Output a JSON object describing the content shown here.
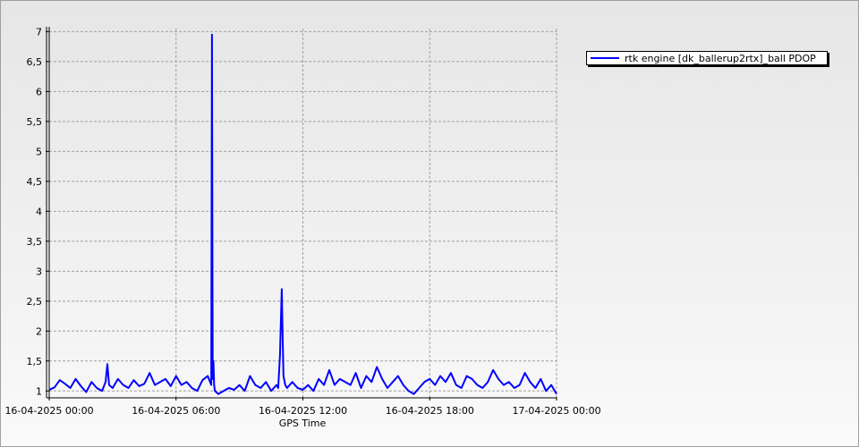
{
  "chart_data": {
    "type": "line",
    "title": "",
    "xlabel": "GPS Time",
    "ylabel": "",
    "x_tick_labels": [
      "16-04-2025 00:00",
      "16-04-2025 06:00",
      "16-04-2025 12:00",
      "16-04-2025 18:00",
      "17-04-2025 00:00"
    ],
    "xlim": [
      "16-04-2025 00:00",
      "17-04-2025 00:00"
    ],
    "y_tick_labels": [
      "1",
      "1,5",
      "2",
      "2,5",
      "3",
      "3,5",
      "4",
      "4,5",
      "5",
      "5,5",
      "6",
      "6,5",
      "7"
    ],
    "ylim": [
      0.9,
      7.05
    ],
    "grid": true,
    "legend_position": "top-right",
    "colors": {
      "series": "#0000ff"
    },
    "series": [
      {
        "name": "rtk engine [dk_ballerup2rtx]_ball PDOP",
        "x": [
          "16-04-2025 00:00",
          "16-04-2025 00:15",
          "16-04-2025 00:30",
          "16-04-2025 00:45",
          "16-04-2025 01:00",
          "16-04-2025 01:15",
          "16-04-2025 01:30",
          "16-04-2025 01:45",
          "16-04-2025 02:00",
          "16-04-2025 02:15",
          "16-04-2025 02:30",
          "16-04-2025 02:40",
          "16-04-2025 02:45",
          "16-04-2025 02:50",
          "16-04-2025 03:00",
          "16-04-2025 03:15",
          "16-04-2025 03:30",
          "16-04-2025 03:45",
          "16-04-2025 04:00",
          "16-04-2025 04:15",
          "16-04-2025 04:30",
          "16-04-2025 04:45",
          "16-04-2025 05:00",
          "16-04-2025 05:15",
          "16-04-2025 05:30",
          "16-04-2025 05:45",
          "16-04-2025 06:00",
          "16-04-2025 06:15",
          "16-04-2025 06:30",
          "16-04-2025 06:45",
          "16-04-2025 07:00",
          "16-04-2025 07:15",
          "16-04-2025 07:30",
          "16-04-2025 07:40",
          "16-04-2025 07:42",
          "16-04-2025 07:44",
          "16-04-2025 07:46",
          "16-04-2025 07:48",
          "16-04-2025 07:50",
          "16-04-2025 08:00",
          "16-04-2025 08:15",
          "16-04-2025 08:30",
          "16-04-2025 08:45",
          "16-04-2025 09:00",
          "16-04-2025 09:15",
          "16-04-2025 09:30",
          "16-04-2025 09:45",
          "16-04-2025 10:00",
          "16-04-2025 10:15",
          "16-04-2025 10:30",
          "16-04-2025 10:45",
          "16-04-2025 10:50",
          "16-04-2025 10:55",
          "16-04-2025 11:00",
          "16-04-2025 11:02",
          "16-04-2025 11:05",
          "16-04-2025 11:10",
          "16-04-2025 11:15",
          "16-04-2025 11:30",
          "16-04-2025 11:45",
          "16-04-2025 12:00",
          "16-04-2025 12:15",
          "16-04-2025 12:30",
          "16-04-2025 12:45",
          "16-04-2025 13:00",
          "16-04-2025 13:15",
          "16-04-2025 13:30",
          "16-04-2025 13:45",
          "16-04-2025 14:00",
          "16-04-2025 14:15",
          "16-04-2025 14:30",
          "16-04-2025 14:45",
          "16-04-2025 15:00",
          "16-04-2025 15:15",
          "16-04-2025 15:30",
          "16-04-2025 15:45",
          "16-04-2025 16:00",
          "16-04-2025 16:15",
          "16-04-2025 16:30",
          "16-04-2025 16:45",
          "16-04-2025 17:00",
          "16-04-2025 17:15",
          "16-04-2025 17:30",
          "16-04-2025 17:45",
          "16-04-2025 18:00",
          "16-04-2025 18:15",
          "16-04-2025 18:30",
          "16-04-2025 18:45",
          "16-04-2025 19:00",
          "16-04-2025 19:15",
          "16-04-2025 19:30",
          "16-04-2025 19:45",
          "16-04-2025 20:00",
          "16-04-2025 20:15",
          "16-04-2025 20:30",
          "16-04-2025 20:45",
          "16-04-2025 21:00",
          "16-04-2025 21:15",
          "16-04-2025 21:30",
          "16-04-2025 21:45",
          "16-04-2025 22:00",
          "16-04-2025 22:15",
          "16-04-2025 22:30",
          "16-04-2025 22:45",
          "16-04-2025 23:00",
          "16-04-2025 23:15",
          "16-04-2025 23:30",
          "16-04-2025 23:45",
          "17-04-2025 00:00"
        ],
        "y": [
          1.02,
          1.06,
          1.18,
          1.12,
          1.05,
          1.2,
          1.08,
          0.98,
          1.15,
          1.05,
          1.0,
          1.15,
          1.45,
          1.1,
          1.05,
          1.2,
          1.1,
          1.05,
          1.18,
          1.08,
          1.12,
          1.3,
          1.1,
          1.15,
          1.2,
          1.08,
          1.25,
          1.1,
          1.15,
          1.05,
          1.0,
          1.18,
          1.25,
          1.1,
          6.95,
          1.2,
          1.5,
          1.1,
          1.0,
          0.95,
          1.0,
          1.05,
          1.02,
          1.1,
          1.0,
          1.25,
          1.1,
          1.05,
          1.15,
          1.0,
          1.1,
          1.05,
          1.6,
          2.7,
          2.05,
          1.25,
          1.1,
          1.05,
          1.15,
          1.05,
          1.02,
          1.1,
          1.0,
          1.2,
          1.1,
          1.35,
          1.1,
          1.2,
          1.15,
          1.1,
          1.3,
          1.05,
          1.25,
          1.15,
          1.4,
          1.2,
          1.05,
          1.15,
          1.25,
          1.1,
          1.0,
          0.95,
          1.05,
          1.15,
          1.2,
          1.1,
          1.25,
          1.15,
          1.3,
          1.1,
          1.05,
          1.25,
          1.2,
          1.1,
          1.05,
          1.15,
          1.35,
          1.2,
          1.1,
          1.15,
          1.05,
          1.1,
          1.3,
          1.15,
          1.05,
          1.2,
          1.0,
          1.1,
          0.95
        ]
      }
    ]
  }
}
